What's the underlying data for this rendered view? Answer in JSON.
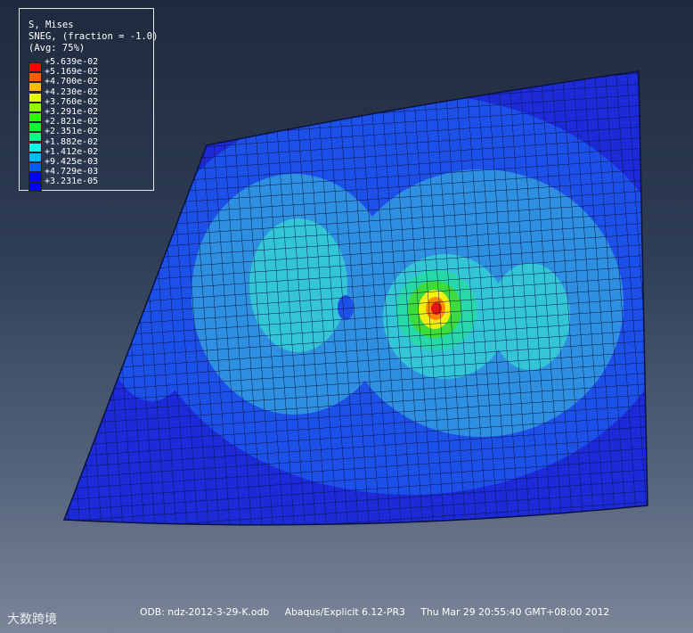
{
  "legend": {
    "variable": "S, Mises",
    "section": "SNEG, (fraction = -1.0)",
    "averaging": "(Avg: 75%)",
    "levels": [
      {
        "value": "+5.639e-02",
        "color": "#ff0000"
      },
      {
        "value": "+5.169e-02",
        "color": "#ff5c00"
      },
      {
        "value": "+4.700e-02",
        "color": "#ffb800"
      },
      {
        "value": "+4.230e-02",
        "color": "#e8ff00"
      },
      {
        "value": "+3.760e-02",
        "color": "#8dff00"
      },
      {
        "value": "+3.291e-02",
        "color": "#2fff00"
      },
      {
        "value": "+2.821e-02",
        "color": "#00ff2e"
      },
      {
        "value": "+2.351e-02",
        "color": "#00ff8b"
      },
      {
        "value": "+1.882e-02",
        "color": "#00ffe8"
      },
      {
        "value": "+1.412e-02",
        "color": "#00b9ff"
      },
      {
        "value": "+9.425e-03",
        "color": "#005cff"
      },
      {
        "value": "+4.729e-03",
        "color": "#0000ff"
      },
      {
        "value": "+3.231e-05",
        "color": "#0000ff"
      }
    ]
  },
  "contour_colors": {
    "deep_blue": "#1d2ad8",
    "blue": "#1d50e8",
    "light_blue": "#2f8fe0",
    "cyan": "#34c6d6",
    "cyan_green": "#27d9a9",
    "green": "#3bdc3b",
    "yellow": "#f1ee14",
    "orange": "#ff8a00",
    "red": "#e21414",
    "mesh_line": "#0a1240"
  },
  "status": {
    "odb": "ODB: ndz-2012-3-29-K.odb",
    "solver": "Abaqus/Explicit 6.12-PR3",
    "date": "Thu Mar 29 20:55:40 GMT+08:00 2012"
  },
  "watermark": "大数跨境"
}
